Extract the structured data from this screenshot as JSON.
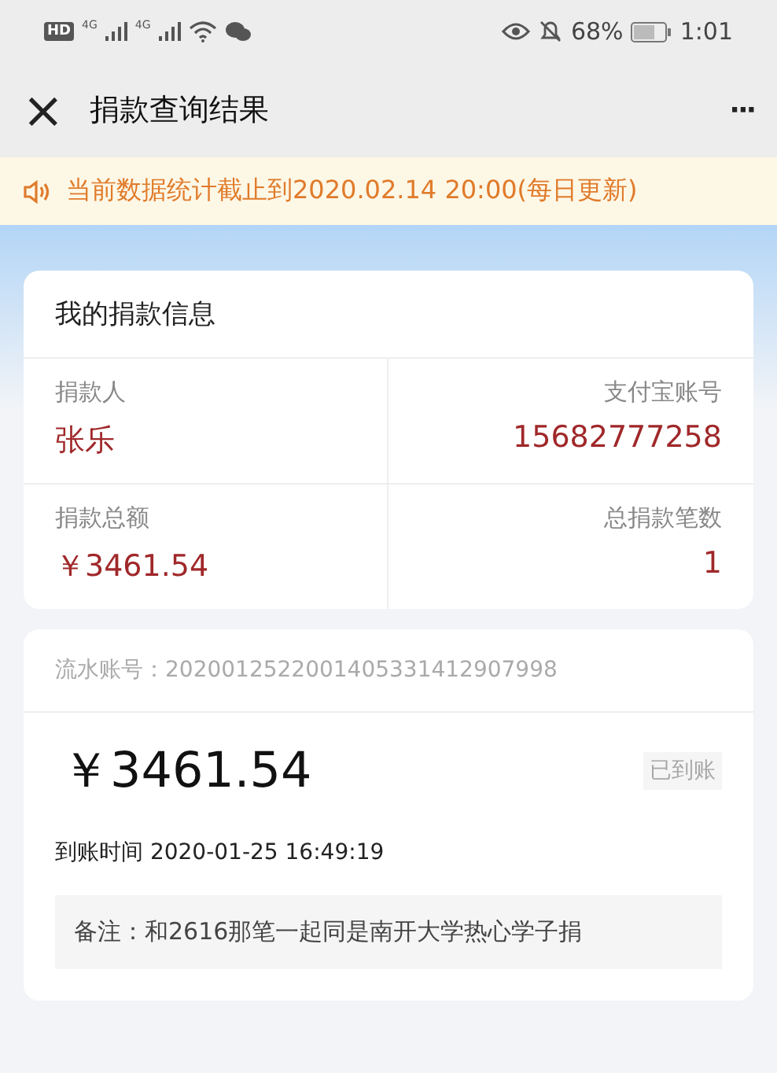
{
  "status_bar": {
    "hd": "HD",
    "signals": [
      "4G",
      "4G"
    ],
    "battery": "68%",
    "time": "1:01"
  },
  "header": {
    "close": "×",
    "title": "捐款查询结果",
    "more": "···"
  },
  "notice": "当前数据统计截止到2020.02.14 20:00(每日更新)",
  "info_card": {
    "title": "我的捐款信息",
    "fields": [
      {
        "label": "捐款人",
        "value": "张乐"
      },
      {
        "label": "支付宝账号",
        "value": "15682777258"
      },
      {
        "label": "捐款总额",
        "value": "￥3461.54"
      },
      {
        "label": "总捐款笔数",
        "value": "1"
      }
    ]
  },
  "record": {
    "serial": "流水账号：2020012522001405331412907998",
    "amount": "￥3461.54",
    "status": "已到账",
    "arrival": "到账时间 2020-01-25 16:49:19",
    "note": "备注：和2616那笔一起同是南开大学热心学子捐"
  }
}
